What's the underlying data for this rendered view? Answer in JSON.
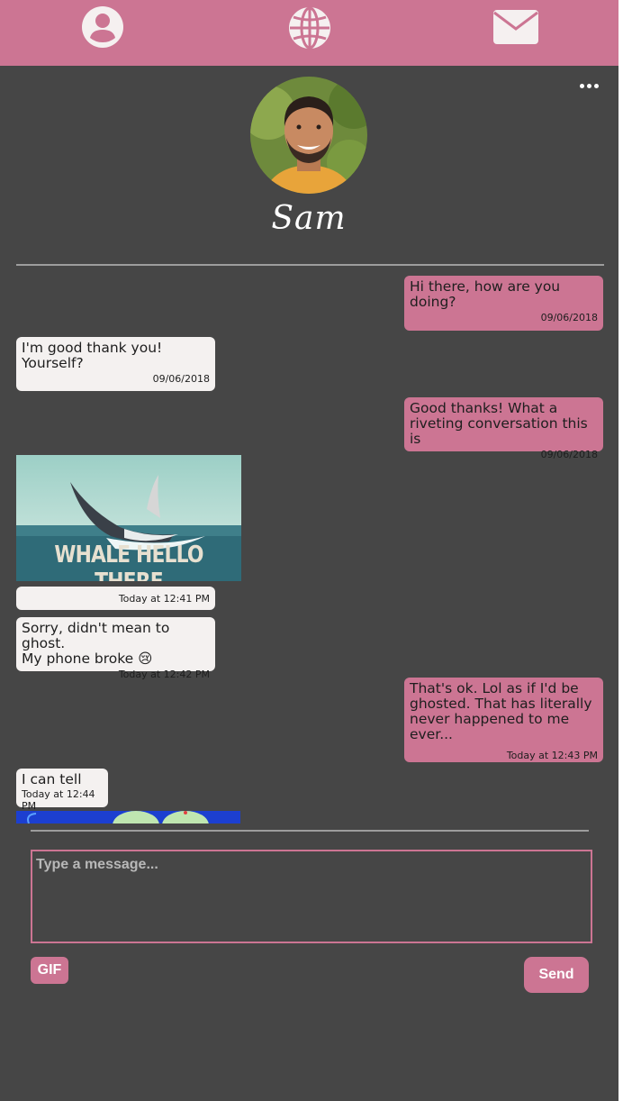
{
  "nav": {
    "icons": [
      "user-icon",
      "globe-icon",
      "mail-icon"
    ]
  },
  "profile": {
    "name": "Sam"
  },
  "messages": [
    {
      "dir": "sent",
      "text": "Hi there, how are you\ndoing?",
      "time": "09/06/2018"
    },
    {
      "dir": "recv",
      "text": "I'm good thank you!\nYourself?",
      "time": "09/06/2018"
    },
    {
      "dir": "sent",
      "text": "Good thanks! What a\nriveting conversation this is",
      "time": "09/06/2018"
    },
    {
      "dir": "recv",
      "type": "gif",
      "gif_caption": "WHALE HELLO THERE",
      "time": "Today at 12:41 PM"
    },
    {
      "dir": "recv",
      "text": "Sorry, didn't mean to ghost.\nMy phone broke 😢",
      "time": "Today at 12:42 PM"
    },
    {
      "dir": "sent",
      "text": "That's ok. Lol as if I'd be\nghosted. That has literally\nnever happened to me\never...",
      "time": "Today at 12:43 PM"
    },
    {
      "dir": "recv",
      "text": "I can tell",
      "time": "Today at 12:44 PM"
    }
  ],
  "composer": {
    "placeholder": "Type a message..."
  },
  "buttons": {
    "gif": "GIF",
    "send": "Send"
  },
  "colors": {
    "accent": "#cc7593",
    "background": "#464646",
    "received_bubble": "#f4f1f0"
  }
}
